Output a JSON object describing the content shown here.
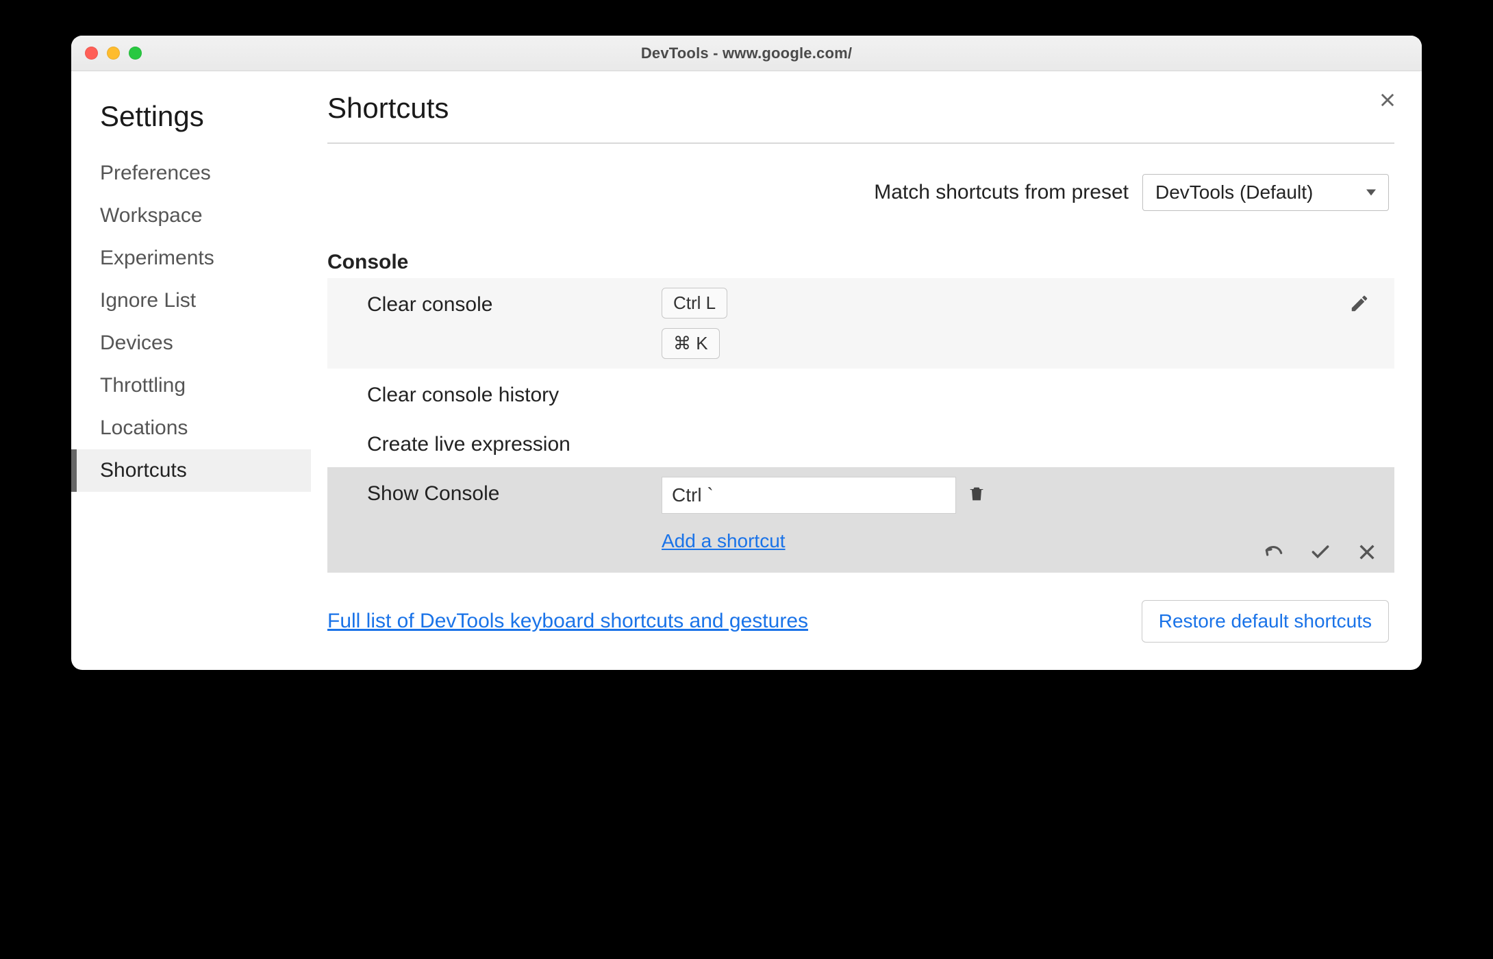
{
  "window": {
    "title": "DevTools - www.google.com/"
  },
  "sidebar": {
    "heading": "Settings",
    "items": [
      {
        "label": "Preferences"
      },
      {
        "label": "Workspace"
      },
      {
        "label": "Experiments"
      },
      {
        "label": "Ignore List"
      },
      {
        "label": "Devices"
      },
      {
        "label": "Throttling"
      },
      {
        "label": "Locations"
      },
      {
        "label": "Shortcuts"
      }
    ],
    "active_index": 7
  },
  "main": {
    "heading": "Shortcuts",
    "preset_label": "Match shortcuts from preset",
    "preset_value": "DevTools (Default)",
    "section": "Console",
    "rows": {
      "clear_console": {
        "label": "Clear console",
        "key1": "Ctrl L",
        "key2": "⌘ K"
      },
      "clear_history": {
        "label": "Clear console history"
      },
      "create_live": {
        "label": "Create live expression"
      },
      "show_console": {
        "label": "Show Console",
        "input_value": "Ctrl `",
        "add_link": "Add a shortcut"
      }
    },
    "footer": {
      "full_link": "Full list of DevTools keyboard shortcuts and gestures",
      "restore": "Restore default shortcuts"
    }
  }
}
